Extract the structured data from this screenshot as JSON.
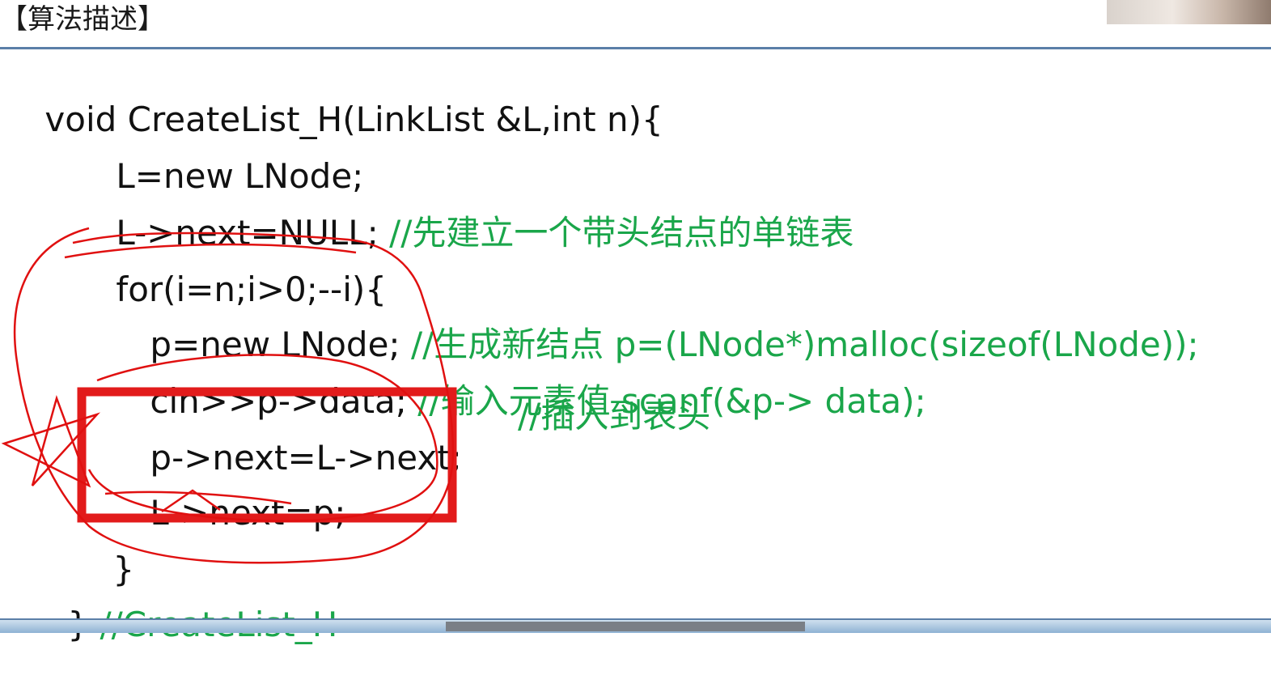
{
  "slide": {
    "title": "【算法描述】"
  },
  "code": {
    "line1": "void CreateList_H(LinkList &L,int n){",
    "line2": "L=new LNode;",
    "line3_code": "L->next=NULL; ",
    "line3_comment": "//先建立一个带头结点的单链表",
    "line4": "for(i=n;i>0;--i){",
    "line5_code": "p=new LNode; ",
    "line5_comment": "//生成新结点 p=(LNode*)malloc(sizeof(LNode));",
    "line6_code": "cin>>p->data; ",
    "line6_comment": "//输入元素值 scanf(&p-> data);",
    "line7_code": "p->next=L->next;",
    "line7_comment": "//插入到表头",
    "line8": "L->next=p;",
    "line9": "}",
    "line10_code": "} ",
    "line10_comment": "//CreateList_H"
  },
  "colors": {
    "comment": "#1aa64a",
    "code": "#111111",
    "highlight_box": "#e21b1b",
    "ink": "#e01010",
    "rule": "#5b7fa8"
  }
}
